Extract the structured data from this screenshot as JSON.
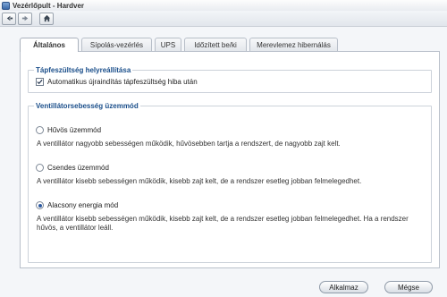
{
  "window": {
    "title": "Vezérlőpult - Hardver"
  },
  "nav": {
    "back_icon": "arrow-left-icon",
    "forward_icon": "arrow-right-icon",
    "home_icon": "home-icon"
  },
  "tabs": [
    {
      "label": "Általános",
      "active": true
    },
    {
      "label": "Sípolás-vezérlés",
      "active": false
    },
    {
      "label": "UPS",
      "active": false
    },
    {
      "label": "Időzített be/ki",
      "active": false
    },
    {
      "label": "Merevlemez hibernálás",
      "active": false
    }
  ],
  "power_recovery": {
    "legend": "Tápfeszültség helyreállítása",
    "checkbox_label": "Automatikus újraindítás tápfeszültség hiba után",
    "checked": true
  },
  "fan_mode": {
    "legend": "Ventillátorsebesség üzemmód",
    "options": [
      {
        "label": "Hűvös üzemmód",
        "description": "A ventillátor nagyobb sebességen működik, hűvösebben tartja a rendszert, de nagyobb zajt kelt.",
        "selected": false
      },
      {
        "label": "Csendes üzemmód",
        "description": "A ventillátor kisebb sebességen működik, kisebb zajt kelt, de a rendszer esetleg jobban felmelegedhet.",
        "selected": false
      },
      {
        "label": "Alacsony energia mód",
        "description": "A ventillátor kisebb sebességen működik, kisebb zajt kelt, de a rendszer esetleg jobban felmelegedhet. Ha a rendszer hűvös, a ventillátor leáll.",
        "selected": true
      }
    ]
  },
  "footer": {
    "apply_label": "Alkalmaz",
    "cancel_label": "Mégse"
  },
  "colors": {
    "legend": "#1a4e8a",
    "accent": "#2d5aa0"
  }
}
